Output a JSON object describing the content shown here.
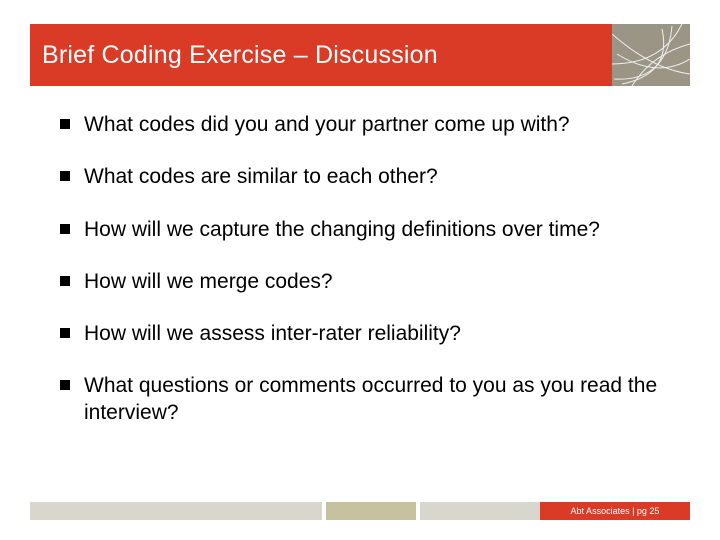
{
  "title": "Brief Coding Exercise – Discussion",
  "bullets": [
    "What codes did you and your partner come up with?",
    "What codes are similar to each other?",
    "How will we capture the changing definitions over time?",
    "How will we merge codes?",
    "How will we assess inter-rater reliability?",
    "What questions or comments occurred to you as you read the interview?"
  ],
  "footer": {
    "org": "Abt Associates",
    "page_label": "pg 25",
    "combined": "Abt Associates | pg 25"
  },
  "colors": {
    "accent": "#da3b26",
    "logo_bg": "#9b9585",
    "bar_grey": "#d7d7cd",
    "bar_olive": "#c6c19f"
  }
}
